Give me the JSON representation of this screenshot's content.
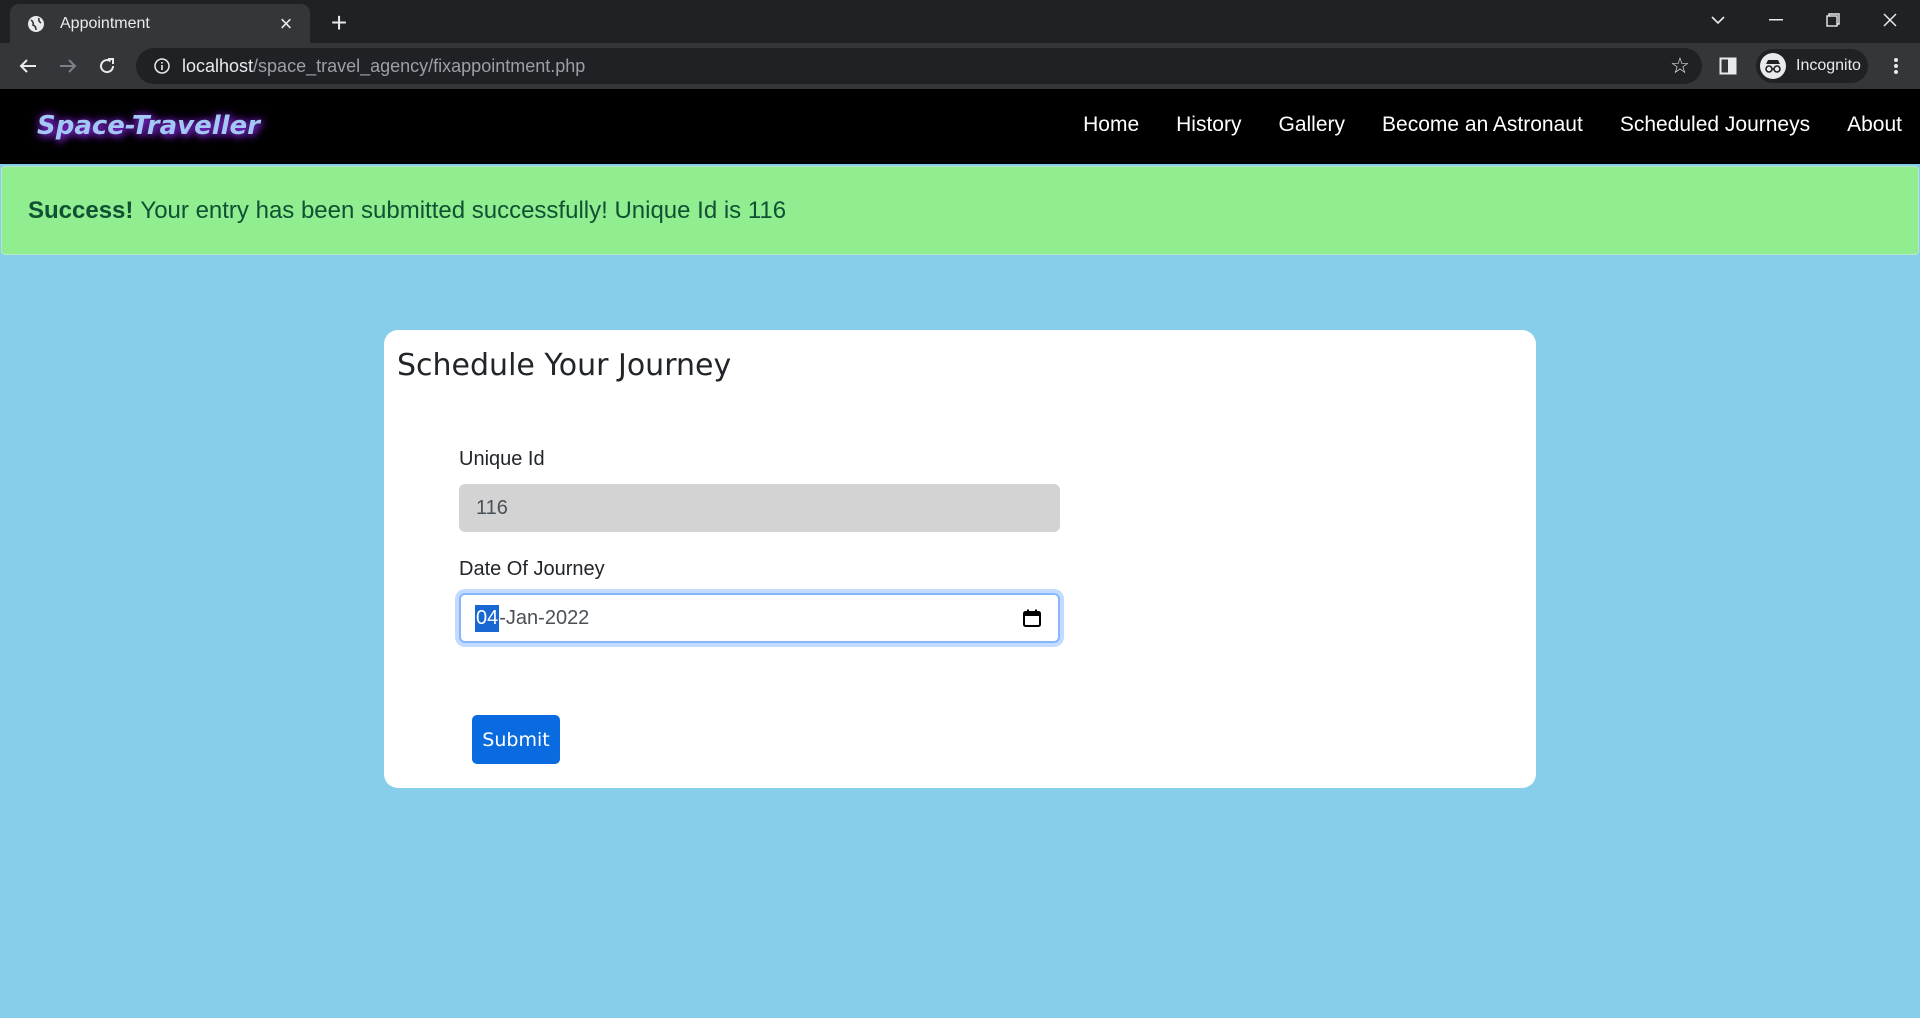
{
  "browser": {
    "tab_title": "Appointment",
    "url_host": "localhost",
    "url_path": "/space_travel_agency/fixappointment.php",
    "profile_label": "Incognito"
  },
  "site": {
    "brand": "Space-Traveller",
    "nav": [
      "Home",
      "History",
      "Gallery",
      "Become an Astronaut",
      "Scheduled Journeys",
      "About"
    ]
  },
  "alert": {
    "strong": "Success!",
    "message": "Your entry has been submitted successfully! Unique Id is 116"
  },
  "form": {
    "title": "Schedule Your Journey",
    "unique_id_label": "Unique Id",
    "unique_id_value": "116",
    "date_label": "Date Of Journey",
    "date_day": "04",
    "date_rest": "-Jan-2022",
    "submit_label": "Submit"
  },
  "colors": {
    "page_bg": "#87ceeb",
    "alert_bg": "#90ee90",
    "primary": "#0a6be1"
  }
}
